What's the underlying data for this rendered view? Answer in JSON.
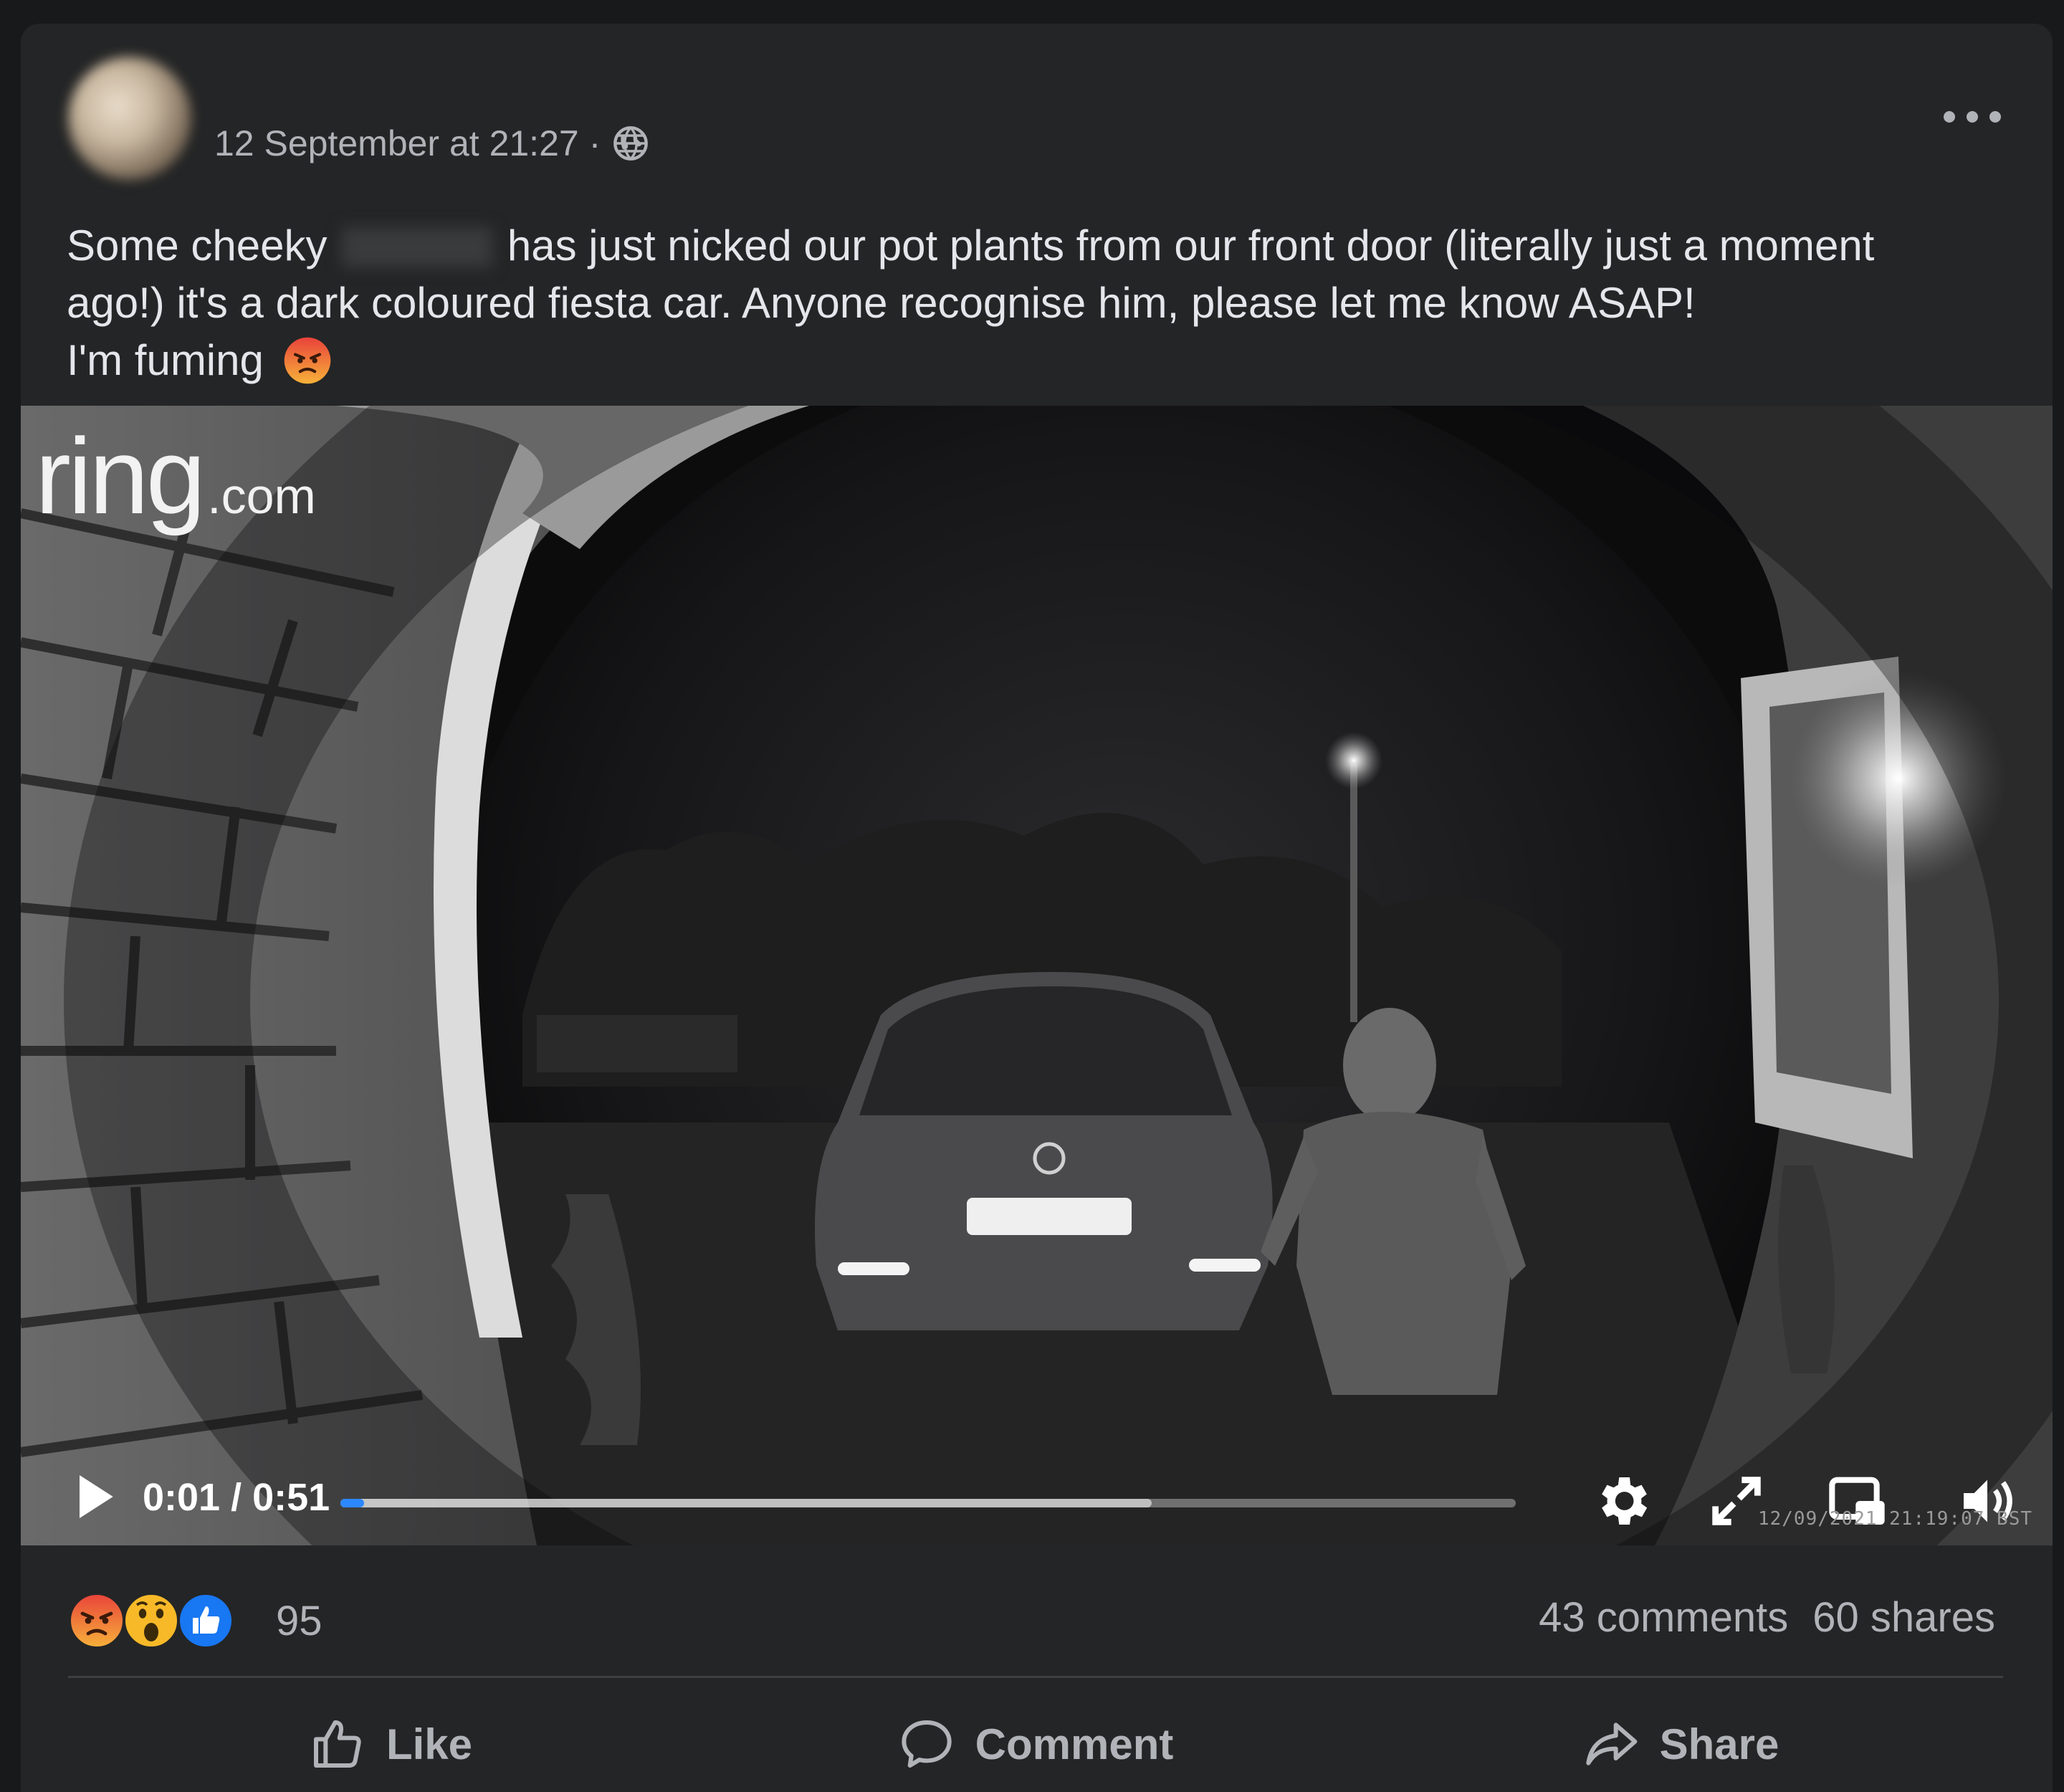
{
  "post": {
    "timestamp": "12 September at 21:27 ·",
    "privacy_icon": "globe-icon",
    "caption": {
      "line1_before": "Some cheeky",
      "line1_after": "has just nicked our pot plants from our front door (literally just a moment",
      "line2": "ago!) it's a dark coloured fiesta car. Anyone recognise him, please let me know ASAP!",
      "line3": "I'm fuming"
    }
  },
  "video": {
    "watermark_brand": "ring",
    "watermark_suffix": ".com",
    "time_display": "0:01 / 0:51",
    "progress_played": 0.02,
    "progress_buffered": 0.69,
    "camera_timestamp": "12/09/2021 21:19:07 BST",
    "icons": [
      "play-icon",
      "gear-icon",
      "expand-icon",
      "pip-icon",
      "volume-icon"
    ]
  },
  "engagement": {
    "reaction_icons": [
      "angry-icon",
      "wow-icon",
      "like-icon"
    ],
    "reaction_count": "95",
    "comments": "43 comments",
    "shares": "60 shares"
  },
  "actions": {
    "like": "Like",
    "comment": "Comment",
    "share": "Share"
  },
  "colors": {
    "background": "#18191a",
    "card": "#242526",
    "text_primary": "#e4e6eb",
    "text_secondary": "#b0b3b8",
    "progress_accent": "#2d88ff",
    "angry_orange": "#f7712c",
    "like_blue": "#1877f2",
    "wow_yellow": "#f7b928"
  }
}
